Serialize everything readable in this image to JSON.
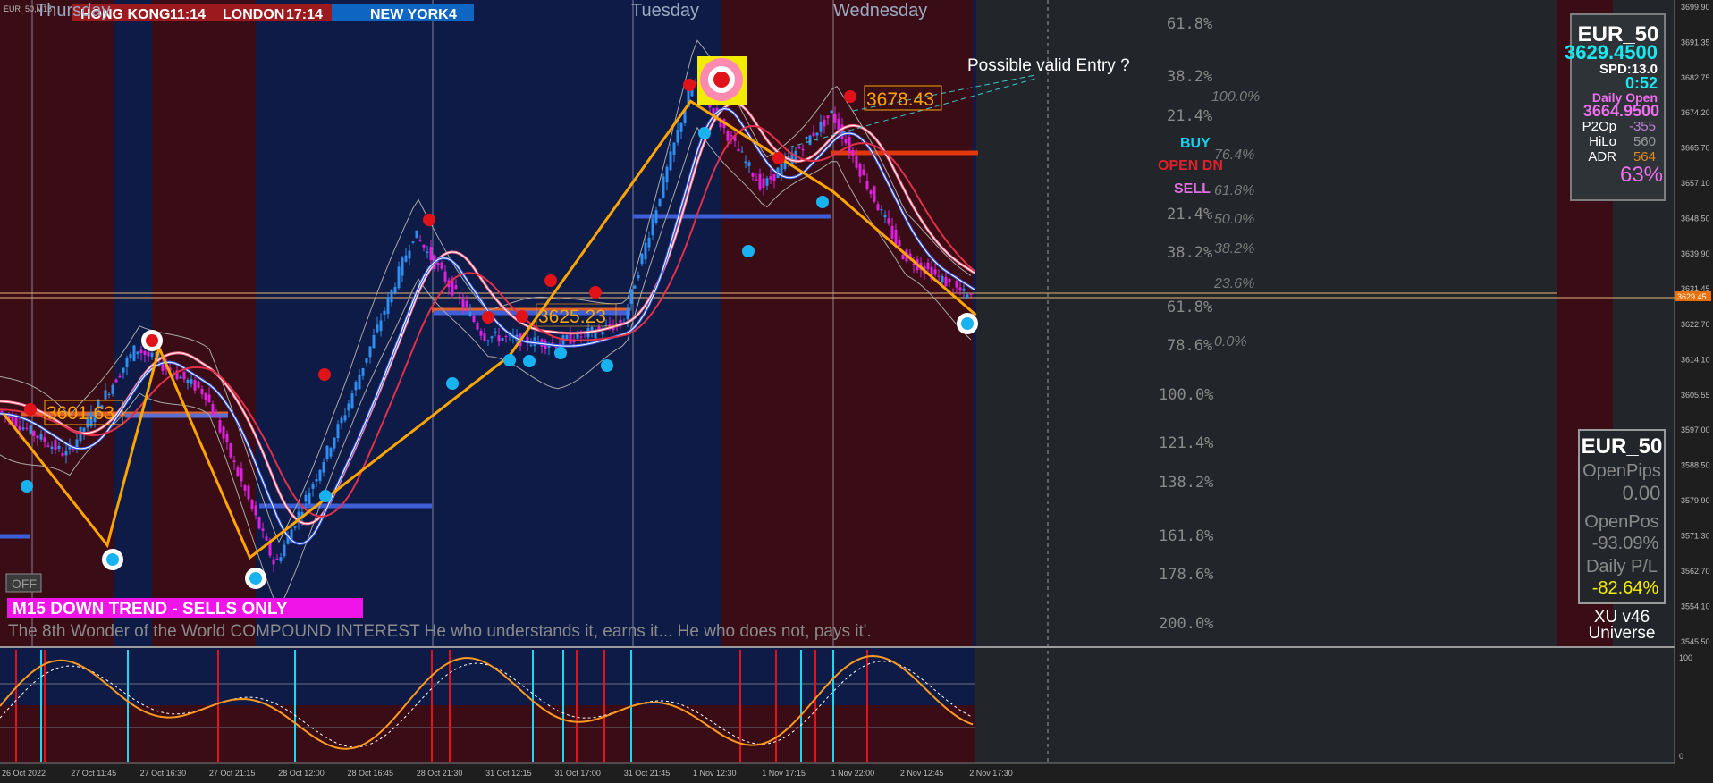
{
  "window": {
    "symbol_tag": "EUR_50,M15"
  },
  "sessions": [
    {
      "label": "HONG KONG",
      "time": "11:14"
    },
    {
      "label": "LONDON",
      "time": "17:14"
    },
    {
      "label": "NEW YORK",
      "time": "4"
    }
  ],
  "day_labels": [
    "Thursday",
    "Tuesday",
    "Wednesday"
  ],
  "fib_labels": [
    "61.8%",
    "38.2%",
    "21.4%",
    "21.4%",
    "38.2%",
    "61.8%",
    "78.6%",
    "100.0%",
    "121.4%",
    "138.2%",
    "161.8%",
    "178.6%",
    "200.0%"
  ],
  "fib_italic_labels": [
    "100.0%",
    "76.4%",
    "61.8%",
    "50.0%",
    "38.2%",
    "23.6%",
    "0.0%"
  ],
  "signals": {
    "buy": "BUY",
    "open": "OPEN DN",
    "sell": "SELL"
  },
  "annotation": "Possible valid Entry ?",
  "level_labels": [
    "3601.63",
    "3625.23",
    "3678.43"
  ],
  "trend_banner": "M15  DOWN TREND - SELLS ONLY",
  "quote_banner": "The 8th Wonder of the World COMPOUND INTEREST He who understands it, earns it... He who does not, pays it'.",
  "off_button": "OFF",
  "info_panel": {
    "symbol": "EUR_50",
    "price": "3629.4500",
    "spread": "SPD:13.0",
    "timer": "0:52",
    "daily_open_label": "Daily Open",
    "daily_open_value": "3664.9500",
    "rows": [
      {
        "label": "P2Op",
        "value": "-355"
      },
      {
        "label": "HiLo",
        "value": "560"
      },
      {
        "label": "ADR",
        "value": "564"
      }
    ],
    "percent": "63%"
  },
  "pos_panel": {
    "symbol": "EUR_50",
    "open_pips_label": "OpenPips",
    "open_pips_value": "0.00",
    "open_pos_label": "OpenPos",
    "open_pos_value": "-93.09%",
    "daily_pl_label": "Daily P/L",
    "daily_pl_value": "-82.64%"
  },
  "brand": {
    "line1": "XU v46",
    "line2": "Universe"
  },
  "price_axis": [
    "3699.90",
    "3691.35",
    "3682.75",
    "3674.20",
    "3665.70",
    "3657.10",
    "3648.50",
    "3639.90",
    "3631.45",
    "3622.70",
    "3614.10",
    "3605.55",
    "3597.00",
    "3588.50",
    "3579.90",
    "3571.30",
    "3562.70",
    "3554.10",
    "3545.50"
  ],
  "current_price_tag": "3629.45",
  "osc_axis": [
    "100",
    "0"
  ],
  "time_axis": [
    "26 Oct 2022",
    "27 Oct 11:45",
    "27 Oct 16:30",
    "27 Oct 21:15",
    "28 Oct 12:00",
    "28 Oct 16:45",
    "28 Oct 21:30",
    "31 Oct 12:15",
    "31 Oct 17:00",
    "31 Oct 21:45",
    "1 Nov 12:30",
    "1 Nov 17:15",
    "1 Nov 22:00",
    "2 Nov 12:45",
    "2 Nov 17:30"
  ],
  "colors": {
    "bg_red": "#3a0d16",
    "bg_blue": "#0d1b46",
    "orange": "#ffa500",
    "cyan": "#19b2f0",
    "red": "#e0131a",
    "magenta": "#ff00ff",
    "blue_line": "#3e5fd8"
  },
  "chart_data": {
    "type": "line",
    "title": "",
    "ylim": [
      3545.5,
      3699.9
    ],
    "x": [
      "26 Oct 2022",
      "27 Oct 11:45",
      "27 Oct 16:30",
      "27 Oct 21:15",
      "28 Oct 12:00",
      "28 Oct 16:45",
      "28 Oct 21:30",
      "31 Oct 12:15",
      "31 Oct 17:00",
      "31 Oct 21:45",
      "1 Nov 12:30",
      "1 Nov 17:15",
      "1 Nov 22:00",
      "2 Nov 12:45",
      "2 Nov 17:30"
    ],
    "series": [
      {
        "values": [
          3602,
          3591,
          3617,
          3606,
          3564,
          3601,
          3645,
          3620,
          3618,
          3623,
          3682,
          3656,
          3674,
          3640,
          3629
        ]
      }
    ],
    "zigzag": [
      [
        0,
        3601
      ],
      [
        0.8,
        3569
      ],
      [
        1.2,
        3617
      ],
      [
        1.9,
        3566
      ],
      [
        3.9,
        3615
      ],
      [
        5.3,
        3677
      ],
      [
        6.4,
        3655
      ],
      [
        7.5,
        3625
      ]
    ],
    "oscillator": {
      "ylim": [
        0,
        100
      ]
    }
  }
}
